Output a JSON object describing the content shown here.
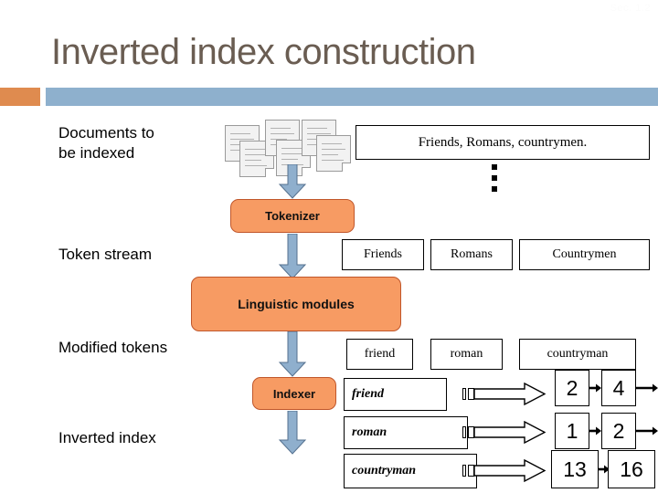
{
  "slide": {
    "corner_note": "Sec. 1.2",
    "title": "Inverted index construction",
    "accent_orange": "#df8b4f",
    "accent_blue": "#8eb0cd",
    "process_fill": "#f79b63",
    "title_color": "#6a5d52"
  },
  "stages": [
    {
      "id": "documents",
      "label": "Documents to\nbe indexed"
    },
    {
      "id": "token-stream",
      "label": "Token stream"
    },
    {
      "id": "modified-tokens",
      "label": "Modified tokens"
    },
    {
      "id": "inverted-index",
      "label": "Inverted index"
    }
  ],
  "source": {
    "sentence": "Friends, Romans, countrymen.",
    "ellipsis_dots": 3,
    "doc_icon_count": 6
  },
  "processes": [
    {
      "id": "tokenizer",
      "label": "Tokenizer"
    },
    {
      "id": "linguistic-modules",
      "label": "Linguistic modules"
    },
    {
      "id": "indexer",
      "label": "Indexer"
    }
  ],
  "token_stream": [
    "Friends",
    "Romans",
    "Countrymen"
  ],
  "modified_tokens": [
    "friend",
    "roman",
    "countryman"
  ],
  "dictionary": [
    {
      "term": "friend",
      "postings": [
        "2",
        "4"
      ],
      "continues": true
    },
    {
      "term": "roman",
      "postings": [
        "1",
        "2"
      ],
      "continues": true
    },
    {
      "term": "countryman",
      "postings": [
        "13",
        "16"
      ],
      "continues": false
    }
  ],
  "icons": {
    "document": "document-icon",
    "down_arrow": "down-arrow-icon",
    "pointer_arrow": "hollow-right-arrow-icon",
    "link_arrow": "black-right-arrow-icon",
    "ellipsis": "vertical-ellipsis-icon"
  }
}
